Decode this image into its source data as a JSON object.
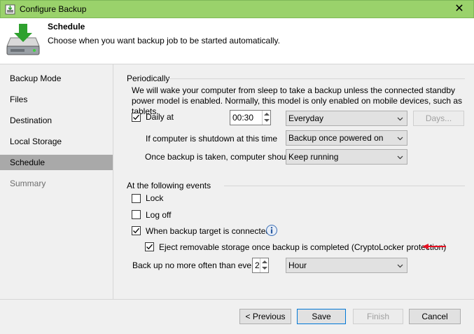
{
  "window": {
    "title": "Configure Backup",
    "titlebar_color": "#9ad26b",
    "close_glyph": "✕"
  },
  "header": {
    "title": "Schedule",
    "subtitle": "Choose when you want backup job to be started automatically."
  },
  "sidebar": {
    "items": [
      {
        "label": "Backup Mode",
        "state": "normal"
      },
      {
        "label": "Files",
        "state": "normal"
      },
      {
        "label": "Destination",
        "state": "normal"
      },
      {
        "label": "Local Storage",
        "state": "normal"
      },
      {
        "label": "Schedule",
        "state": "selected"
      },
      {
        "label": "Summary",
        "state": "disabled"
      }
    ]
  },
  "periodically": {
    "section_title": "Periodically",
    "note": "We will wake your computer from sleep to take a backup unless the connected standby power model is enabled. Normally, this model is only enabled on mobile devices, such as tablets.",
    "daily": {
      "label": "Daily at",
      "checked": true,
      "time": "00:30",
      "frequency": "Everyday",
      "days_button": "Days..."
    },
    "shutdown": {
      "label": "If computer is shutdown at this time",
      "value": "Backup once powered on"
    },
    "after_backup": {
      "label": "Once backup is taken, computer should",
      "value": "Keep running"
    }
  },
  "events": {
    "section_title": "At the following events",
    "lock": {
      "label": "Lock",
      "checked": false
    },
    "logoff": {
      "label": "Log off",
      "checked": false
    },
    "target_connected": {
      "label": "When backup target is connected",
      "checked": true
    },
    "eject": {
      "label": "Eject removable storage once backup is completed (CryptoLocker protection)",
      "checked": true
    },
    "frequency": {
      "label": "Back up no more often than every",
      "value": "2",
      "unit": "Hour"
    }
  },
  "footer": {
    "previous": "< Previous",
    "save": "Save",
    "finish": "Finish",
    "cancel": "Cancel"
  },
  "colors": {
    "accent_arrow": "#e81123",
    "selected_nav": "#a9a9a9",
    "primary_border": "#0078d7"
  }
}
